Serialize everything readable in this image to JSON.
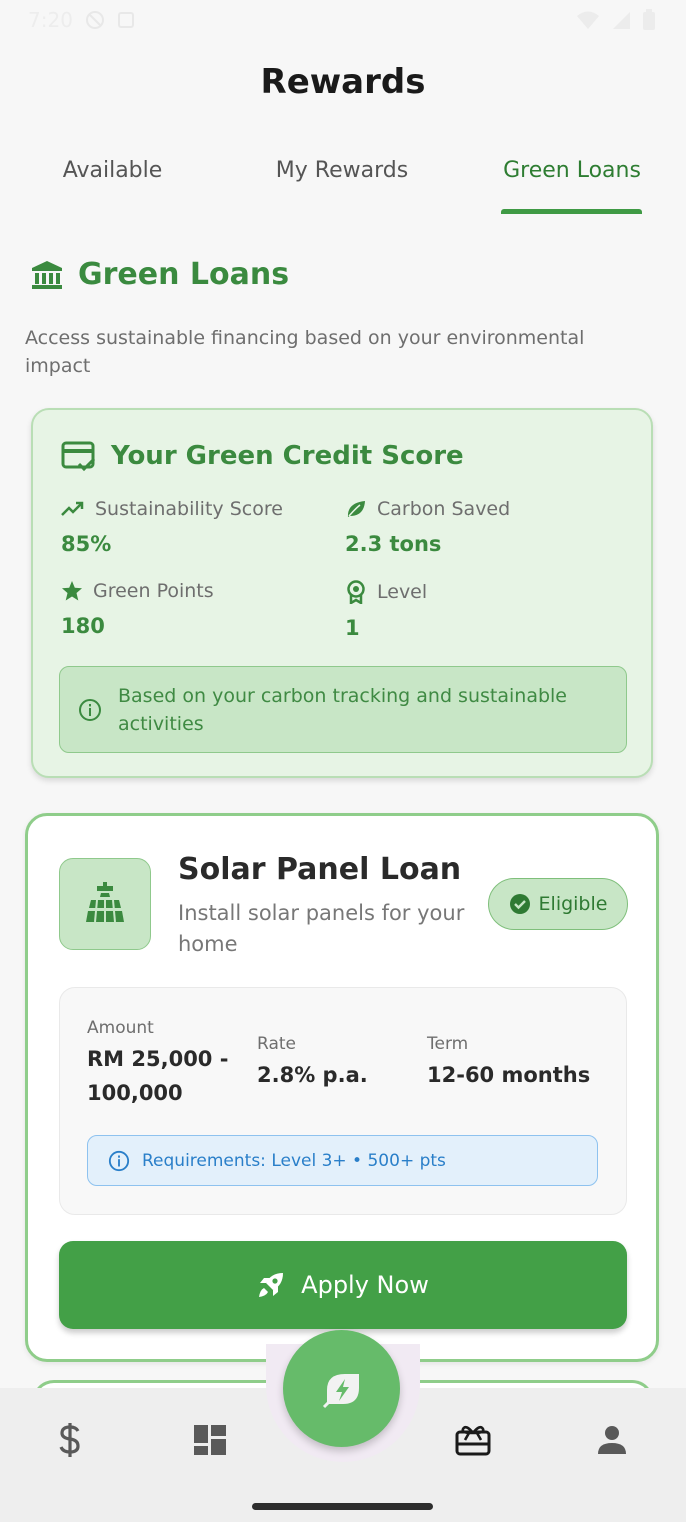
{
  "status_bar": {
    "time": "7:20"
  },
  "app": {
    "title": "Rewards"
  },
  "tabs": [
    {
      "label": "Available"
    },
    {
      "label": "My Rewards"
    },
    {
      "label": "Green Loans",
      "active": true
    }
  ],
  "section": {
    "title": "Green Loans",
    "description": "Access sustainable financing based on your environmental impact"
  },
  "credit_score": {
    "title": "Your Green Credit Score",
    "metrics": [
      {
        "label": "Sustainability Score",
        "value": "85%",
        "icon": "trending-up-icon"
      },
      {
        "label": "Carbon Saved",
        "value": "2.3 tons",
        "icon": "leaf-icon"
      },
      {
        "label": "Green Points",
        "value": "180",
        "icon": "star-icon"
      },
      {
        "label": "Level",
        "value": "1",
        "icon": "award-icon"
      }
    ],
    "info": "Based on your carbon tracking and sustainable activities"
  },
  "loan": {
    "title": "Solar Panel Loan",
    "subtitle": "Install solar panels for your home",
    "badge": "Eligible",
    "amount_label": "Amount",
    "amount_value": "RM 25,000 - 100,000",
    "rate_label": "Rate",
    "rate_value": "2.8% p.a.",
    "term_label": "Term",
    "term_value": "12-60 months",
    "requirements": "Requirements: Level 3+ • 500+ pts",
    "apply_label": "Apply Now"
  },
  "bottom_nav": {
    "items": [
      {
        "icon": "dollar-icon"
      },
      {
        "icon": "dashboard-icon"
      },
      {
        "icon": "eco-bolt-icon"
      },
      {
        "icon": "gift-card-icon",
        "active": true
      },
      {
        "icon": "person-icon"
      }
    ]
  },
  "colors": {
    "accent": "#3b8a3f",
    "button": "#43a047",
    "fab": "#66bb6a",
    "info_blue": "#2a7fc9"
  }
}
